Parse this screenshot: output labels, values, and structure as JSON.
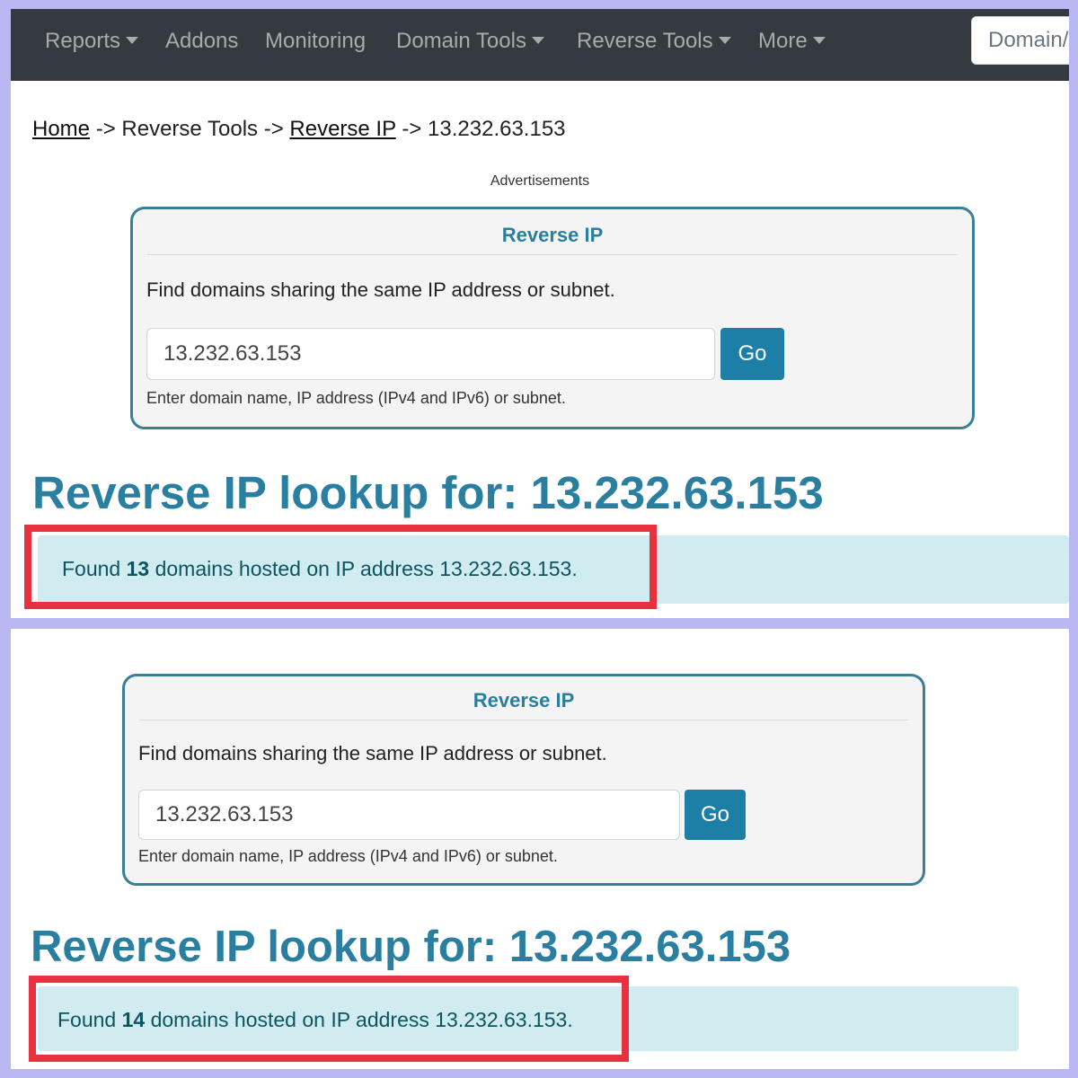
{
  "navbar": {
    "items": [
      {
        "label": "Reports",
        "dropdown": true
      },
      {
        "label": "Addons",
        "dropdown": false
      },
      {
        "label": "Monitoring",
        "dropdown": false
      },
      {
        "label": "Domain Tools",
        "dropdown": true
      },
      {
        "label": "Reverse Tools",
        "dropdown": true
      },
      {
        "label": "More",
        "dropdown": true
      }
    ],
    "search_placeholder": "Domain/"
  },
  "breadcrumb": {
    "home": "Home",
    "sep": "->",
    "reverse_tools": "Reverse Tools",
    "reverse_ip": "Reverse IP",
    "current": "13.232.63.153"
  },
  "ads_label": "Advertisements",
  "tool_card": {
    "title": "Reverse IP",
    "description": "Find domains sharing the same IP address or subnet.",
    "input_value": "13.232.63.153",
    "go_label": "Go",
    "help_text": "Enter domain name, IP address (IPv4 and IPv6) or subnet."
  },
  "heading": "Reverse IP lookup for: 13.232.63.153",
  "results": {
    "top": {
      "prefix": "Found",
      "count": "13",
      "suffix": "domains hosted on IP address 13.232.63.153."
    },
    "bottom": {
      "prefix": "Found",
      "count": "14",
      "suffix": "domains hosted on IP address 13.232.63.153."
    }
  },
  "colors": {
    "background": "#b9b8f3",
    "navbar": "#343a40",
    "accent": "#2a7fa0",
    "button": "#1e7fa6",
    "alert_bg": "#d1ecf1",
    "alert_text": "#0c5460",
    "highlight": "#e8303e"
  }
}
